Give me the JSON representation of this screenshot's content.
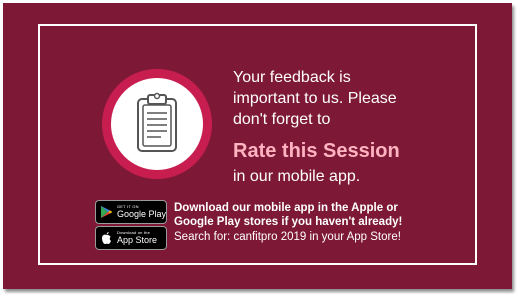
{
  "slide": {
    "background_color": "#7d1937",
    "accent_color": "#c81d4f",
    "highlight_color": "#ffb3c0"
  },
  "badge": {
    "icon": "clipboard-icon"
  },
  "message": {
    "line1": "Your feedback is",
    "line2": "important to us. Please",
    "line3": "don't forget to",
    "highlight": "Rate this Session",
    "line4": "in our mobile app."
  },
  "stores": {
    "google": {
      "icon": "google-play-icon",
      "small_label": "GET IT ON",
      "label": "Google Play"
    },
    "apple": {
      "icon": "apple-icon",
      "small_label": "Download on the",
      "label": "App Store"
    }
  },
  "download": {
    "line1": "Download our mobile app in the Apple or",
    "line2": "Google Play stores if you haven't already!",
    "search": "Search for: canfitpro 2019 in your App Store!"
  }
}
